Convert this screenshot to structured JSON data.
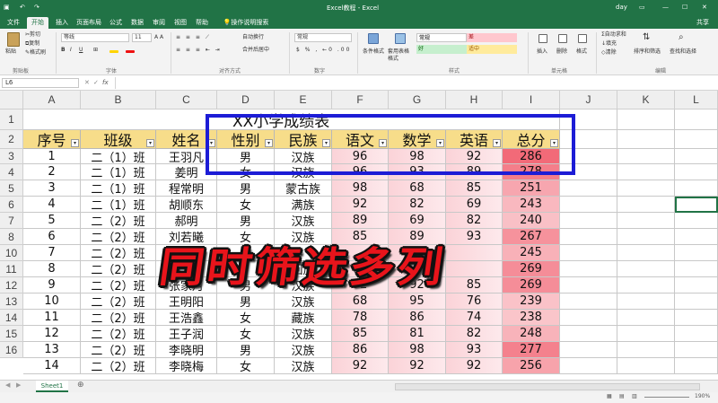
{
  "titlebar": {
    "menu_file": "文件",
    "doc_title": "Excel教程 - Excel",
    "user": "day",
    "share": "共享"
  },
  "tabs": [
    "文件",
    "开始",
    "插入",
    "页面布局",
    "公式",
    "数据",
    "审阅",
    "视图",
    "帮助",
    "操作说明搜索"
  ],
  "ribbon": {
    "paste": "粘贴",
    "cut": "剪切",
    "copy": "复制",
    "format_painter": "格式刷",
    "font_name": "等线",
    "font_size": "11",
    "bold": "B",
    "italic": "I",
    "underline": "U",
    "wrap": "自动换行",
    "merge": "合并后居中",
    "number_format": "常规",
    "cond_format": "条件格式",
    "table_format": "套用表格格式",
    "style_normal": "常规",
    "style_bad": "差",
    "style_good": "好",
    "style_neutral": "适中",
    "insert": "插入",
    "delete": "删除",
    "format": "格式",
    "autosum": "自动求和",
    "fill": "填充",
    "clear": "清除",
    "sort_filter": "排序和筛选",
    "find_select": "查找和选择",
    "groups": [
      "剪贴板",
      "字体",
      "对齐方式",
      "数字",
      "样式",
      "单元格",
      "编辑"
    ]
  },
  "formula_bar": {
    "name_box": "L6",
    "fx": "fx",
    "value": ""
  },
  "columns": [
    "A",
    "B",
    "C",
    "D",
    "E",
    "F",
    "G",
    "H",
    "I",
    "J",
    "K",
    "L"
  ],
  "row_numbers": [
    "1",
    "2",
    "3",
    "4",
    "5",
    "6",
    "7",
    "8",
    "10",
    "11",
    "12",
    "13",
    "14",
    "15",
    "16"
  ],
  "title_cell": "XX小学成绩表",
  "headers": [
    "序号",
    "班级",
    "姓名",
    "性别",
    "民族",
    "语文",
    "数学",
    "英语",
    "总分"
  ],
  "rows": [
    [
      "1",
      "二（1）班",
      "王羽凡",
      "男",
      "汉族",
      "96",
      "98",
      "92",
      "286"
    ],
    [
      "2",
      "二（1）班",
      "姜明",
      "女",
      "汉族",
      "96",
      "93",
      "89",
      "278"
    ],
    [
      "3",
      "二（1）班",
      "程常明",
      "男",
      "蒙古族",
      "98",
      "68",
      "85",
      "251"
    ],
    [
      "4",
      "二（1）班",
      "胡顺东",
      "女",
      "满族",
      "92",
      "82",
      "69",
      "243"
    ],
    [
      "5",
      "二（2）班",
      "郝明",
      "男",
      "汉族",
      "89",
      "69",
      "82",
      "240"
    ],
    [
      "6",
      "二（2）班",
      "刘若曦",
      "女",
      "汉族",
      "85",
      "89",
      "93",
      "267"
    ],
    [
      "7",
      "二（2）班",
      "",
      "",
      "",
      "",
      "",
      "",
      "245"
    ],
    [
      "8",
      "二（2）班",
      "",
      "",
      "回族",
      "",
      "",
      "",
      "269"
    ],
    [
      "9",
      "二（2）班",
      "张家月",
      "男",
      "汉族",
      "92",
      "92",
      "85",
      "269"
    ],
    [
      "10",
      "二（2）班",
      "王明阳",
      "男",
      "汉族",
      "68",
      "95",
      "76",
      "239"
    ],
    [
      "11",
      "二（2）班",
      "王浩鑫",
      "女",
      "藏族",
      "78",
      "86",
      "74",
      "238"
    ],
    [
      "12",
      "二（2）班",
      "王子润",
      "女",
      "汉族",
      "85",
      "81",
      "82",
      "248"
    ],
    [
      "13",
      "二（2）班",
      "李晓明",
      "男",
      "汉族",
      "86",
      "98",
      "93",
      "277"
    ],
    [
      "14",
      "二（2）班",
      "李晓梅",
      "女",
      "汉族",
      "92",
      "92",
      "92",
      "256"
    ]
  ],
  "total_fill": [
    1.0,
    0.84,
    0.52,
    0.38,
    0.32,
    0.68,
    0.44,
    0.72,
    0.72,
    0.3,
    0.28,
    0.42,
    0.82,
    0.55
  ],
  "overlay_text": "同时筛选多列",
  "sheet_tab": "Sheet1",
  "zoom": "190%",
  "colors": {
    "accent": "#217346",
    "header_fill": "#f7dd8a",
    "scale_strong": "#f26a78",
    "scale_light": "#fde8ea",
    "highlight_box": "#1c1cd6",
    "overlay_text": "#e8141b"
  }
}
